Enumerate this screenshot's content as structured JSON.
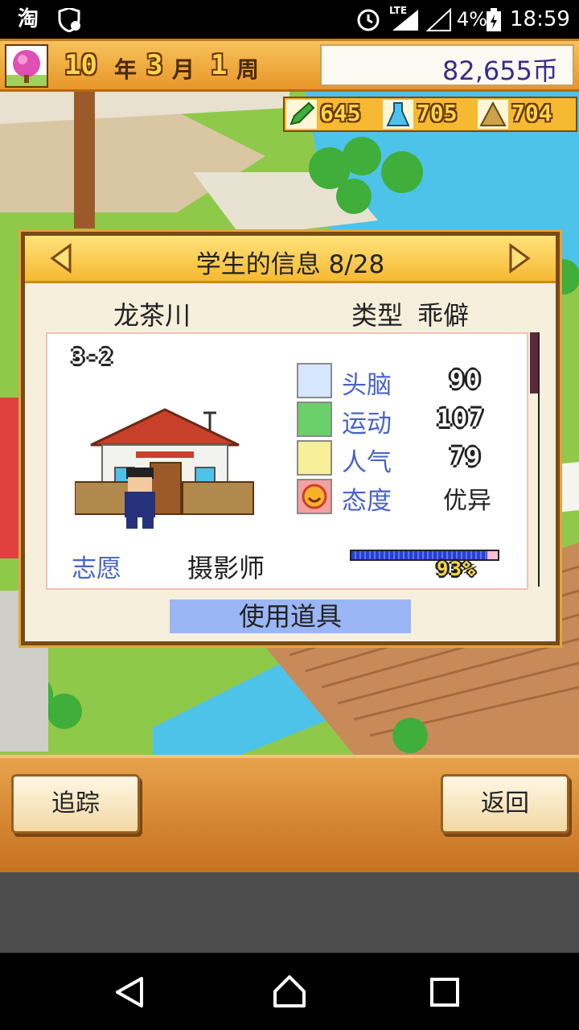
{
  "status_bar": {
    "left_icons": [
      "taobao-icon",
      "vpn-shield-icon"
    ],
    "app_text": "淘",
    "lte": "LTE",
    "battery": "4%",
    "time": "18:59"
  },
  "top_bar": {
    "year_num": "10",
    "year_unit": "年",
    "month_num": "3",
    "month_unit": "月",
    "week_num": "1",
    "week_unit": "周",
    "money": "82,655币",
    "resources": [
      {
        "icon": "pencil-icon",
        "value": "645"
      },
      {
        "icon": "flask-icon",
        "value": "705"
      },
      {
        "icon": "pyramid-icon",
        "value": "704"
      }
    ]
  },
  "dialog": {
    "title": "学生的信息 8/28",
    "student_name": "龙茶川",
    "type_label": "类型",
    "type_value": "乖僻",
    "class_label": "3-2",
    "stats": [
      {
        "icon": "brain-icon",
        "label": "头脑",
        "value": "90"
      },
      {
        "icon": "shoe-icon",
        "label": "运动",
        "value": "107"
      },
      {
        "icon": "lightbulb-icon",
        "label": "人气",
        "value": "79"
      },
      {
        "icon": "smiley-icon",
        "label": "态度",
        "value": "优异"
      }
    ],
    "aspiration_label": "志愿",
    "aspiration_value": "摄影师",
    "progress_percent": 93,
    "progress_text": "93%",
    "use_item_button": "使用道具"
  },
  "bottom_bar": {
    "track_button": "追踪",
    "back_button": "返回"
  },
  "colors": {
    "accent_orange": "#e8962a",
    "stat_blue": "#4a63c9",
    "progress_blue": "#2a3fd0",
    "button_highlight": "#9ab6f5"
  }
}
